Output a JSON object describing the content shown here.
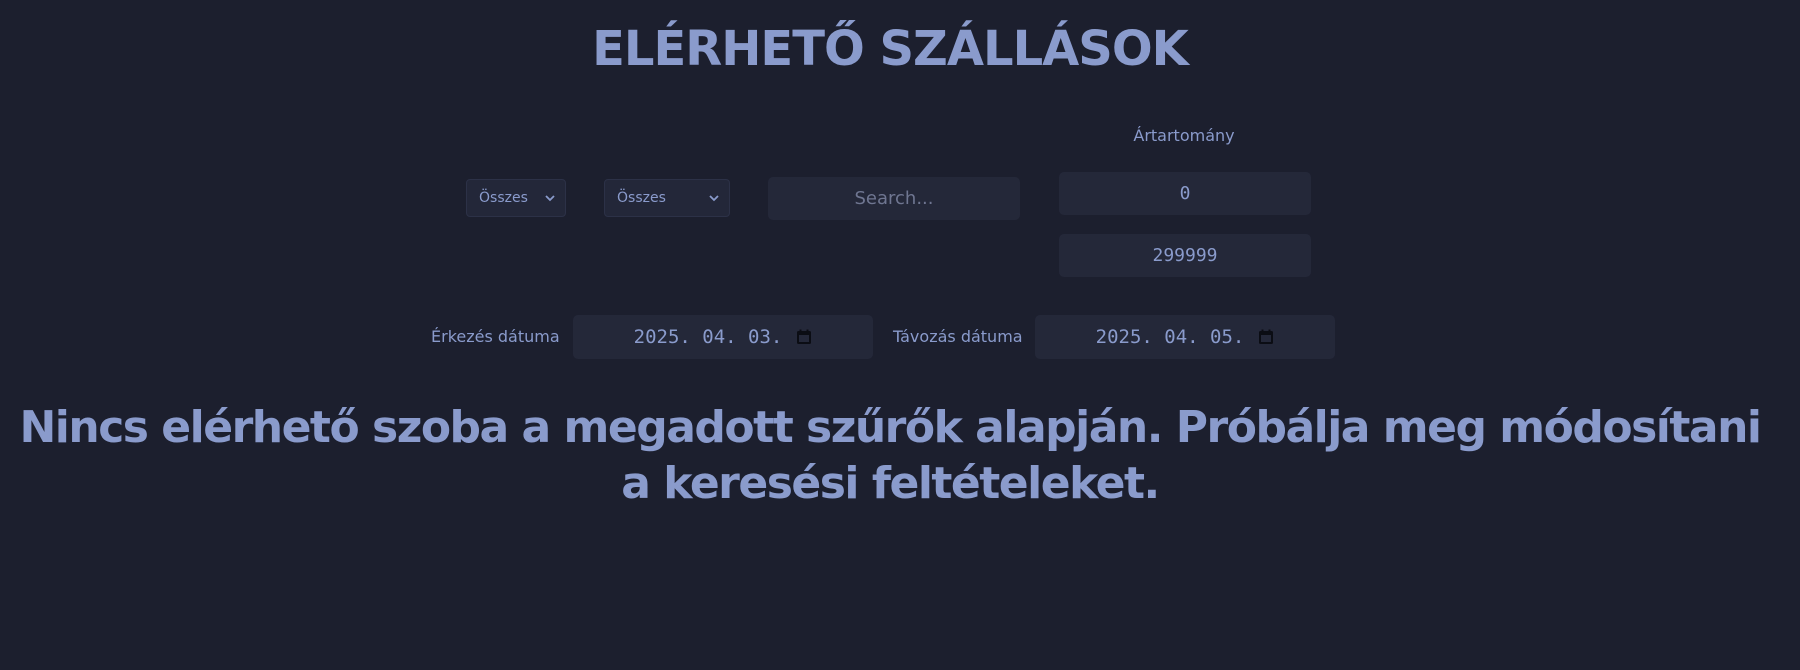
{
  "page": {
    "title": "ELÉRHETŐ SZÁLLÁSOK"
  },
  "filters": {
    "select_1": {
      "selected": "Összes"
    },
    "select_2": {
      "selected": "Összes"
    },
    "search": {
      "placeholder": "Search...",
      "value": ""
    },
    "price_range": {
      "label": "Ártartomány",
      "min": "0",
      "max": "299999"
    },
    "arrival": {
      "label": "Érkezés dátuma",
      "value": "2025. 04. 03."
    },
    "departure": {
      "label": "Távozás dátuma",
      "value": "2025. 04. 05."
    }
  },
  "results": {
    "empty_message": "Nincs elérhető szoba a megadott szűrők alapján. Próbálja meg módosítani a keresési feltételeket."
  },
  "icons": {
    "select_chevron": "chevron-down-icon",
    "date_picker": "calendar-icon"
  },
  "colors": {
    "background": "#1c1f2e",
    "text": "#8a9bcc",
    "field": "#242839"
  }
}
